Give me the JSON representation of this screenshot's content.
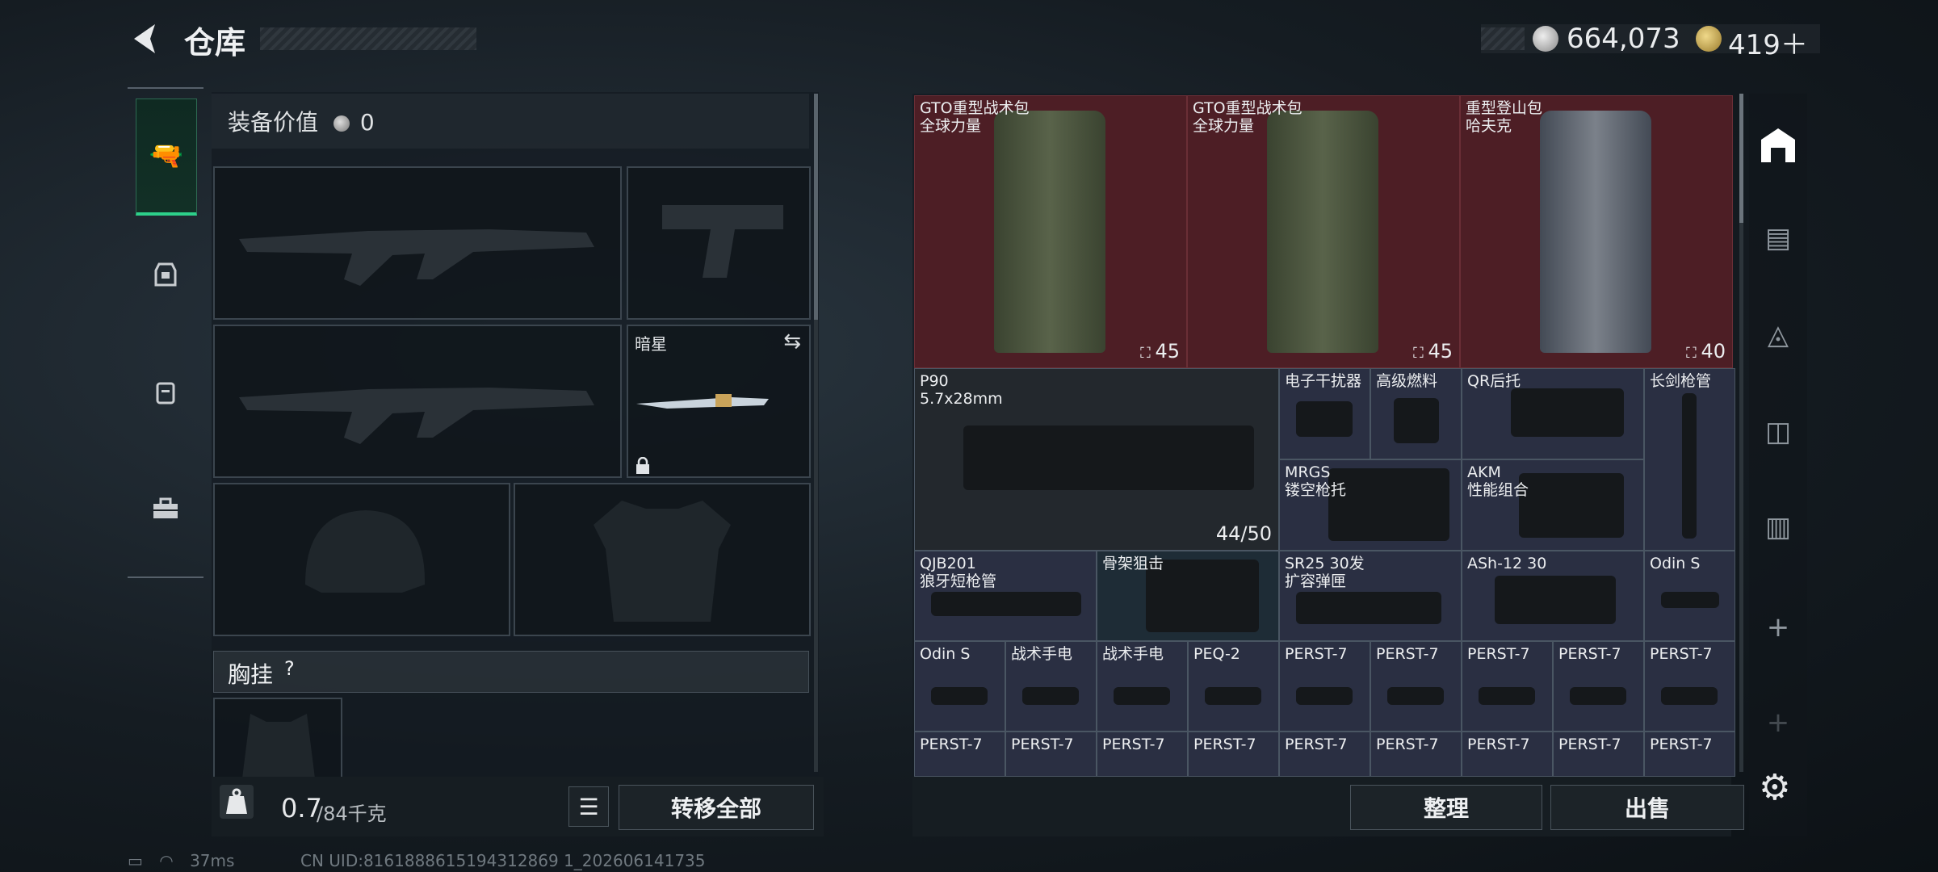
{
  "header": {
    "title": "仓库"
  },
  "currency": {
    "silver": "664,073",
    "gold": "419"
  },
  "tabs": [
    "weapons",
    "rig",
    "backpack",
    "toolbox"
  ],
  "equipment": {
    "value_label": "装备价值",
    "value": "0",
    "melee_name": "暗星",
    "chest_rig_label": "胸挂",
    "help": "?"
  },
  "capacity": {
    "current": "0.7",
    "max": "/84千克"
  },
  "buttons": {
    "transfer_all": "转移全部",
    "sort": "整理",
    "sell": "出售"
  },
  "stash": {
    "backpacks": [
      {
        "name": "GTO重型战术包\n全球力量",
        "count": "45"
      },
      {
        "name": "GTO重型战术包\n全球力量",
        "count": "45"
      },
      {
        "name": "重型登山包\n哈夫克",
        "count": "40"
      }
    ],
    "items": [
      {
        "name": "P90\n5.7x28mm",
        "count": "44/50"
      },
      {
        "name": "电子干扰器"
      },
      {
        "name": "高级燃料"
      },
      {
        "name": "QR后托"
      },
      {
        "name": "长剑枪管"
      },
      {
        "name": "MRGS\n镂空枪托"
      },
      {
        "name": "AKM\n性能组合"
      },
      {
        "name": "QJB201\n狼牙短枪管"
      },
      {
        "name": "骨架狙击"
      },
      {
        "name": "SR25 30发\n扩容弹匣"
      },
      {
        "name": "ASh-12 30"
      },
      {
        "name": "Odin S"
      },
      {
        "name": "Odin S"
      },
      {
        "name": "战术手电"
      },
      {
        "name": "战术手电"
      },
      {
        "name": "PEQ-2"
      },
      {
        "name": "PERST-7"
      },
      {
        "name": "PERST-7"
      },
      {
        "name": "PERST-7"
      },
      {
        "name": "PERST-7"
      },
      {
        "name": "PERST-7"
      },
      {
        "name": "PERST-7"
      },
      {
        "name": "PERST-7"
      },
      {
        "name": "PERST-7"
      },
      {
        "name": "PERST-7"
      },
      {
        "name": "PERST-7"
      },
      {
        "name": "PERST-7"
      },
      {
        "name": "PERST-7"
      },
      {
        "name": "PERST-7"
      },
      {
        "name": "PERST-7"
      }
    ]
  },
  "status": {
    "ping": "37ms",
    "uid": "CN UID:8161888615194312869 1_202606141735"
  },
  "colors": {
    "accent": "#2dd08a",
    "backpack_cell": "#4d1e25",
    "item_cell": "#2a2f42"
  }
}
